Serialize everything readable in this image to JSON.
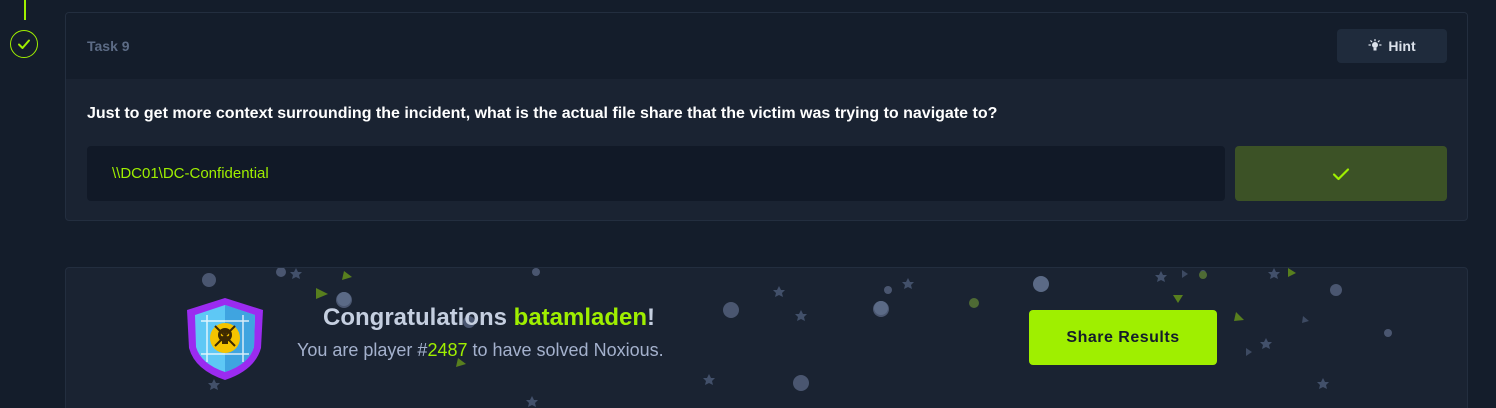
{
  "colors": {
    "background": "#141d2b",
    "card": "#1a2332",
    "accent": "#9fef00",
    "submit_done": "#3c5226"
  },
  "timeline": {
    "status_icon": "check-icon"
  },
  "task": {
    "label": "Task 9",
    "hint_label": "Hint",
    "hint_icon": "lightbulb-icon",
    "question": "Just to get more context surrounding the incident, what is the actual file share that the victim was trying to navigate to?",
    "answer_value": "\\\\DC01\\DC-Confidential",
    "submit_icon": "check-icon"
  },
  "congrats": {
    "badge_icon": "skull-shield-badge-icon",
    "title_prefix": "Congratulations ",
    "username": "batamladen",
    "title_suffix": "!",
    "sub_prefix": "You are player #",
    "player_number": "2487",
    "sub_suffix": " to have solved Noxious.",
    "share_label": "Share Results"
  }
}
